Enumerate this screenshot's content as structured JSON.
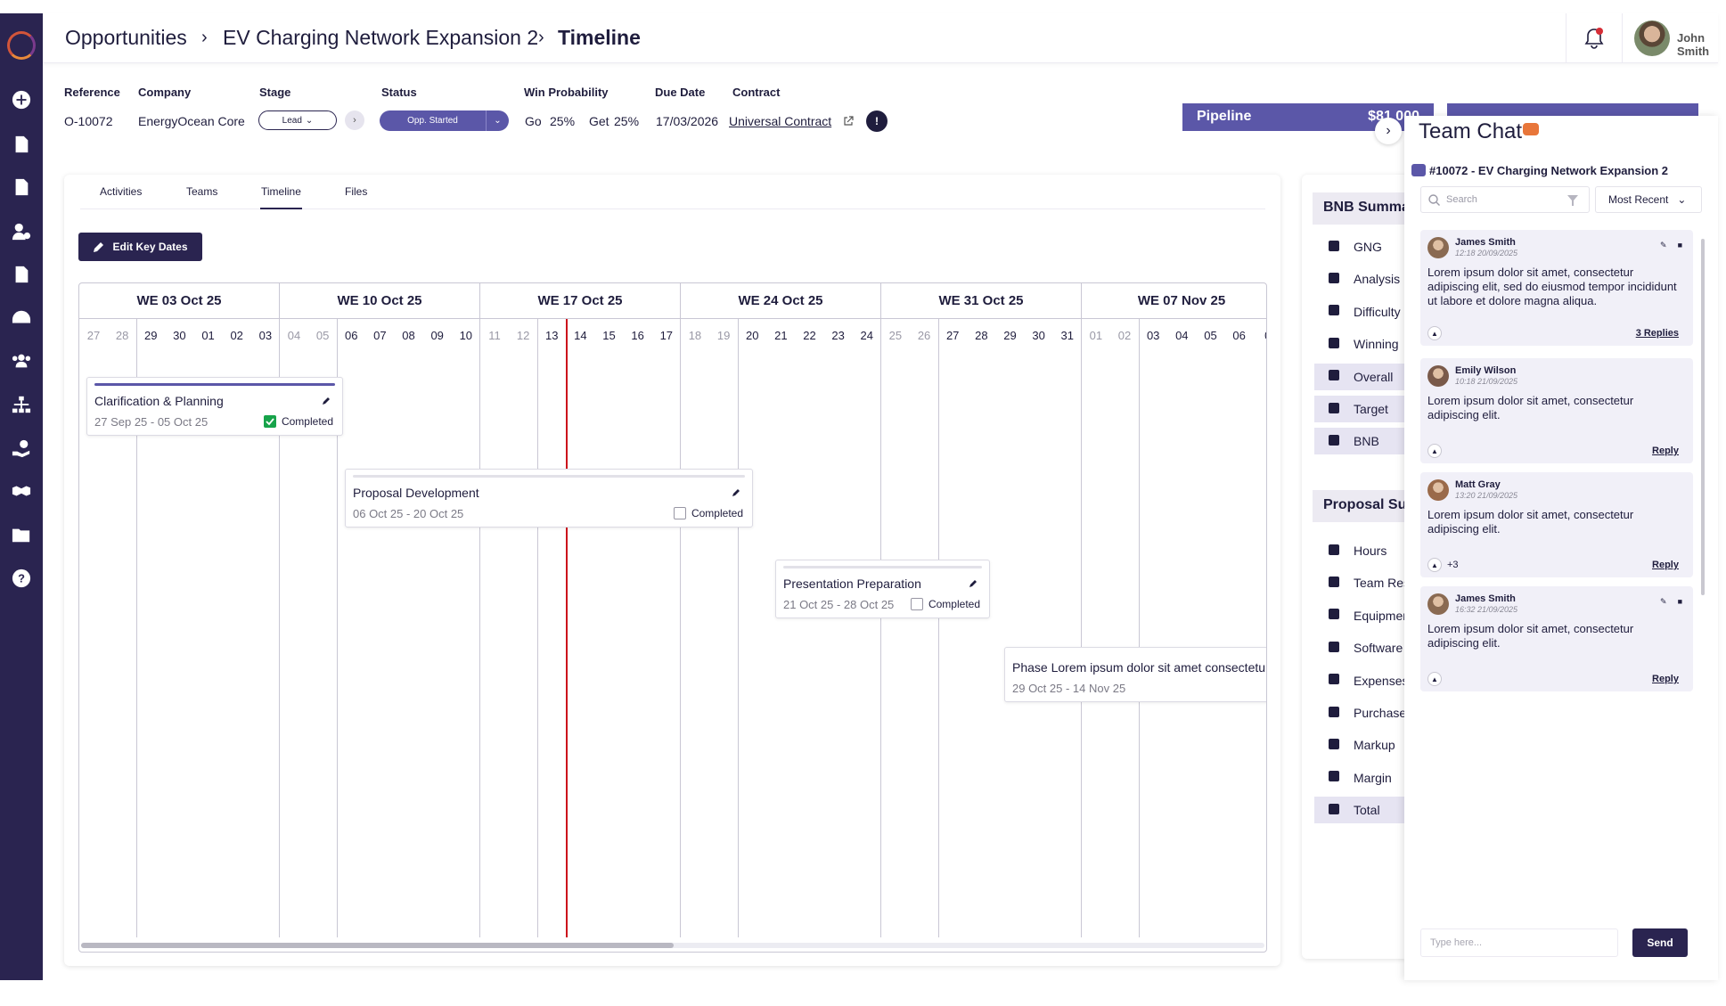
{
  "breadcrumb": [
    "Opportunities",
    "EV Charging Network Expansion 2",
    "Timeline"
  ],
  "user": {
    "name": "John Smith",
    "notification_count": "1"
  },
  "header": {
    "labels": [
      "Reference",
      "Company",
      "Stage",
      "Status",
      "Win Probability",
      "Due Date",
      "Contract"
    ],
    "reference": "O-10072",
    "company": "EnergyOcean Core",
    "stage": "Lead",
    "status": "Opp. Started",
    "go_label": "Go",
    "go_value": "25%",
    "get_label": "Get",
    "get_value": "25%",
    "due_date": "17/03/2026",
    "contract": "Universal Contract",
    "pipeline_label": "Pipeline",
    "pipeline_value": "$81 000"
  },
  "tabs": [
    "Activities",
    "Teams",
    "Timeline",
    "Files"
  ],
  "active_tab": "Timeline",
  "edit_key_dates": "Edit Key Dates",
  "timeline": {
    "weeks": [
      "WE 03 Oct 25",
      "WE 10 Oct 25",
      "WE 17 Oct 25",
      "WE 24 Oct 25",
      "WE 31 Oct 25",
      "WE 07 Nov 25"
    ],
    "days": [
      "27",
      "28",
      "29",
      "30",
      "01",
      "02",
      "03",
      "04",
      "05",
      "06",
      "07",
      "08",
      "09",
      "10",
      "11",
      "12",
      "13",
      "14",
      "15",
      "16",
      "17",
      "18",
      "19",
      "20",
      "21",
      "22",
      "23",
      "24",
      "25",
      "26",
      "27",
      "28",
      "29",
      "30",
      "31",
      "01",
      "02",
      "03",
      "04",
      "05",
      "06",
      "0"
    ],
    "weekend_indices": [
      0,
      1,
      7,
      8,
      14,
      15,
      21,
      22,
      28,
      29,
      35,
      36
    ],
    "today_index": 16,
    "tasks": [
      {
        "title": "Clarification & Planning",
        "dates": "27 Sep 25 - 05 Oct 25",
        "status": "Completed",
        "completed": true
      },
      {
        "title": "Proposal Development",
        "dates": "06 Oct 25 - 20 Oct 25",
        "status": "Completed",
        "completed": false
      },
      {
        "title": "Presentation Preparation",
        "dates": "21 Oct 25 - 28 Oct 25",
        "status": "Completed",
        "completed": false
      },
      {
        "title": "Phase Lorem ipsum dolor sit amet consectetur",
        "dates": "29 Oct 25 - 14 Nov 25",
        "status": "",
        "completed": false
      }
    ]
  },
  "bnb": {
    "heading": "BNB Summary",
    "items": [
      {
        "label": "GNG",
        "icon": "thumbs-up-icon"
      },
      {
        "label": "Analysis",
        "icon": "list-icon"
      },
      {
        "label": "Difficulty",
        "icon": "bars-icon"
      },
      {
        "label": "Winning",
        "icon": "map-icon"
      },
      {
        "label": "Overall",
        "icon": "chat-bubble-icon"
      },
      {
        "label": "Target",
        "icon": "comments-icon"
      },
      {
        "label": "BNB",
        "icon": "file-icon"
      }
    ],
    "proposal_heading": "Proposal Summary",
    "proposal_items": [
      {
        "label": "Hours",
        "icon": "clock-icon"
      },
      {
        "label": "Team Resources",
        "icon": "person-icon"
      },
      {
        "label": "Equipment",
        "icon": "tools-icon"
      },
      {
        "label": "Software",
        "icon": "gear-icon"
      },
      {
        "label": "Expenses",
        "icon": "dollar-icon"
      },
      {
        "label": "Purchases",
        "icon": "cart-icon"
      },
      {
        "label": "Markup",
        "icon": "sort-icon"
      },
      {
        "label": "Margin",
        "icon": "percent-icon"
      },
      {
        "label": "Total",
        "icon": "sigma-icon"
      }
    ]
  },
  "chat": {
    "title": "Team Chat",
    "topic": "#10072 - EV Charging Network Expansion 2",
    "search_placeholder": "Search",
    "sort": "Most Recent",
    "messages": [
      {
        "name": "James Smith",
        "time": "12:18 20/09/2025",
        "text": "Lorem ipsum dolor sit amet, consectetur adipiscing elit, sed do eiusmod tempor incididunt ut labore et dolore magna aliqua.",
        "reply": "3 Replies",
        "reactions": "",
        "editable": true
      },
      {
        "name": "Emily Wilson",
        "time": "10:18 21/09/2025",
        "text": "Lorem ipsum dolor sit amet, consectetur adipiscing elit.",
        "reply": "Reply",
        "reactions": "",
        "editable": false
      },
      {
        "name": "Matt Gray",
        "time": "13:20 21/09/2025",
        "text": "Lorem ipsum dolor sit amet, consectetur adipiscing elit.",
        "reply": "Reply",
        "reactions": "+3",
        "editable": false
      },
      {
        "name": "James Smith",
        "time": "16:32 21/09/2025",
        "text": "Lorem ipsum dolor sit amet, consectetur adipiscing elit.",
        "reply": "Reply",
        "reactions": "",
        "editable": true
      }
    ],
    "input_placeholder": "Type here...",
    "send": "Send"
  }
}
